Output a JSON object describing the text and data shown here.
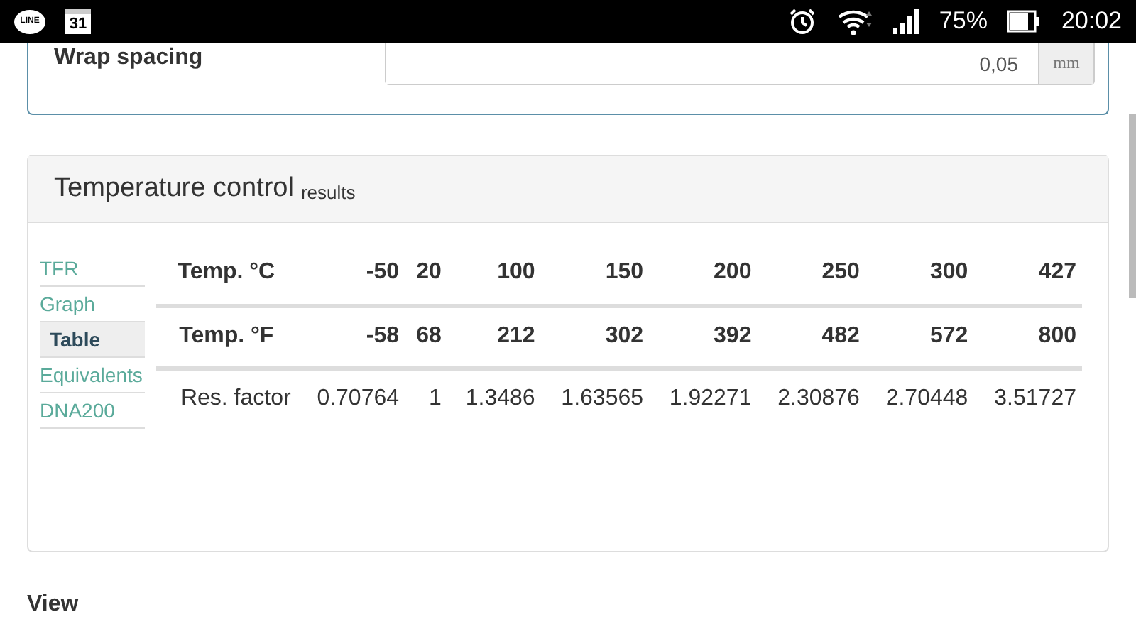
{
  "status_bar": {
    "app_badge": "LINE",
    "calendar_day": "31",
    "battery": "75%",
    "time": "20:02"
  },
  "wrap_spacing": {
    "label": "Wrap spacing",
    "value": "0,05",
    "unit": "mm"
  },
  "results": {
    "title": "Temperature control",
    "subtitle": "results",
    "tabs": [
      {
        "label": "TFR",
        "selected": false
      },
      {
        "label": "Graph",
        "selected": false
      },
      {
        "label": "Table",
        "selected": true
      },
      {
        "label": "Equivalents",
        "selected": false
      },
      {
        "label": "DNA200",
        "selected": false
      }
    ],
    "rows": [
      {
        "kind": "header",
        "label": "Temp. °C",
        "cells": [
          "-50",
          "20",
          "100",
          "150",
          "200",
          "250",
          "300",
          "427"
        ]
      },
      {
        "kind": "header",
        "label": "Temp. °F",
        "cells": [
          "-58",
          "68",
          "212",
          "302",
          "392",
          "482",
          "572",
          "800"
        ]
      },
      {
        "kind": "data",
        "label": "Res. factor",
        "cells": [
          "0.70764",
          "1",
          "1.3486",
          "1.63565",
          "1.92271",
          "2.30876",
          "2.70448",
          "3.51727"
        ]
      }
    ]
  },
  "next_section": "View"
}
